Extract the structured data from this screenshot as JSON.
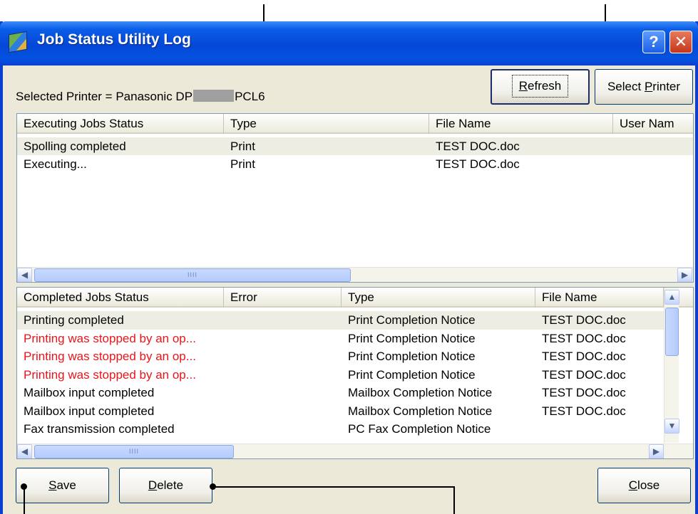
{
  "window": {
    "title": "Job Status Utility Log",
    "help_label": "?",
    "close_label": "✕"
  },
  "toolbar": {
    "refresh_label_u": "R",
    "refresh_label_rest": "efresh",
    "select_printer_pre": "Select ",
    "select_printer_u": "P",
    "select_printer_rest": "rinter"
  },
  "selected_printer": {
    "prefix": "Selected Printer = Panasonic DP",
    "suffix": "PCL6"
  },
  "executing": {
    "columns": [
      "Executing Jobs Status",
      "Type",
      "File Name",
      "User Nam"
    ],
    "rows": [
      {
        "status": "Spolling completed",
        "type": "Print",
        "file": "TEST DOC.doc"
      },
      {
        "status": "Executing...",
        "type": "Print",
        "file": "TEST DOC.doc"
      }
    ],
    "scroll_grip": "IIII"
  },
  "completed": {
    "columns": [
      "Completed Jobs Status",
      "Error",
      "Type",
      "File Name"
    ],
    "rows": [
      {
        "status": "Printing completed",
        "error": "",
        "type": "Print Completion Notice",
        "file": "TEST DOC.doc",
        "color": "#000000"
      },
      {
        "status": "Printing was stopped by an op...",
        "error": "",
        "type": "Print Completion Notice",
        "file": "TEST DOC.doc",
        "color": "#e8141a"
      },
      {
        "status": "Printing was stopped by an op...",
        "error": "",
        "type": "Print Completion Notice",
        "file": "TEST DOC.doc",
        "color": "#e8141a"
      },
      {
        "status": "Printing was stopped by an op...",
        "error": "",
        "type": "Print Completion Notice",
        "file": "TEST DOC.doc",
        "color": "#e8141a"
      },
      {
        "status": "Mailbox input completed",
        "error": "",
        "type": "Mailbox Completion Notice",
        "file": "TEST DOC.doc",
        "color": "#000000"
      },
      {
        "status": "Mailbox input completed",
        "error": "",
        "type": "Mailbox Completion Notice",
        "file": "TEST DOC.doc",
        "color": "#000000"
      },
      {
        "status": "Fax transmission completed",
        "error": "",
        "type": "PC Fax Completion Notice",
        "file": "",
        "color": "#000000"
      }
    ],
    "scroll_grip": "IIII"
  },
  "footer": {
    "save_u": "S",
    "save_rest": "ave",
    "delete_u": "D",
    "delete_rest": "elete",
    "close_u": "C",
    "close_rest": "lose"
  },
  "colors": {
    "titlebar": "#0547d6",
    "dialog_bg": "#ece9d8",
    "error_text": "#e8141a"
  },
  "icons": {
    "window_icon": "app-cube-icon",
    "help": "help-icon",
    "close": "close-icon",
    "scroll_left": "arrow-left-icon",
    "scroll_right": "arrow-right-icon",
    "scroll_up": "arrow-up-icon",
    "scroll_down": "arrow-down-icon"
  }
}
